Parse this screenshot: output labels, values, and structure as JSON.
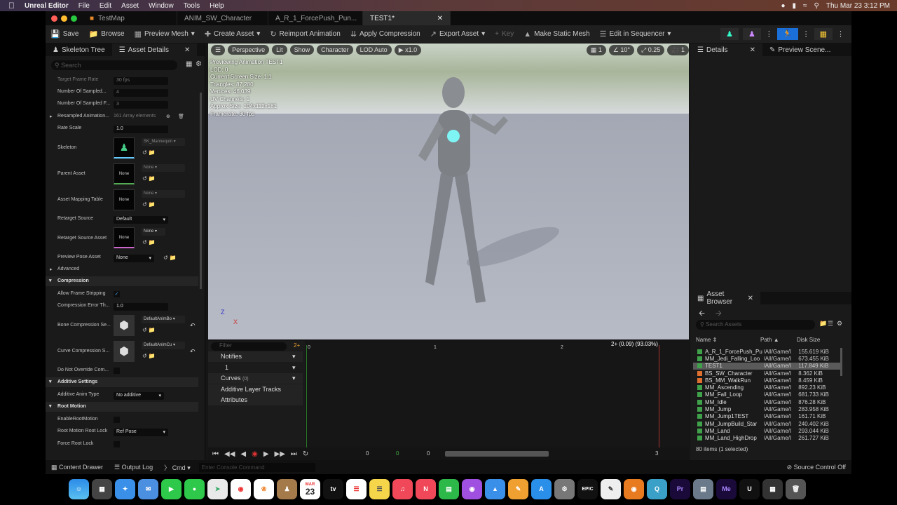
{
  "macbar": {
    "app": "Unreal Editor",
    "menus": [
      "File",
      "Edit",
      "Asset",
      "Window",
      "Tools",
      "Help"
    ],
    "clock": "Thu Mar 23  3:12 PM"
  },
  "tabs": [
    {
      "label": "TestMap"
    },
    {
      "label": "ANIM_SW_Character"
    },
    {
      "label": "A_R_1_ForcePush_Pun..."
    },
    {
      "label": "TEST1*"
    }
  ],
  "toolbar": {
    "save": "Save",
    "browse": "Browse",
    "preview_mesh": "Preview Mesh",
    "create_asset": "Create Asset",
    "reimport": "Reimport Animation",
    "apply_compression": "Apply Compression",
    "export_asset": "Export Asset",
    "key": "Key",
    "make_static": "Make Static Mesh",
    "edit_seq": "Edit in Sequencer"
  },
  "left": {
    "tab1": "Skeleton Tree",
    "tab2": "Asset Details",
    "search": "Search",
    "rows": [
      {
        "label": "Target Frame Rate",
        "value": "30 fps"
      },
      {
        "label": "Number Of Sampled...",
        "value": "4"
      },
      {
        "label": "Number Of Sampled F...",
        "value": "3"
      },
      {
        "label": "Resampled Animation...",
        "value": "161 Array elements"
      },
      {
        "label": "Rate Scale",
        "value": "1.0"
      }
    ],
    "skeleton": "Skeleton",
    "skeleton_val": "SK_Mannequin",
    "parent": "Parent Asset",
    "parent_val": "None",
    "none": "None",
    "mapping": "Asset Mapping Table",
    "retarget": "Retarget Source",
    "retarget_val": "Default",
    "retarget_asset": "Retarget Source Asset",
    "preview_pose": "Preview Pose Asset",
    "advanced": "Advanced",
    "compression": "Compression",
    "allow_strip": "Allow Frame Stripping",
    "comp_err": "Compression Error Th...",
    "comp_err_val": "1.0",
    "bone_comp": "Bone Compression Se...",
    "bone_comp_val": "DefaultAnimBo",
    "curve_comp": "Curve Compression S...",
    "curve_comp_val": "DefaultAnimCu",
    "no_override": "Do Not Override Com...",
    "additive": "Additive Settings",
    "add_type": "Additive Anim Type",
    "add_type_val": "No additive",
    "root": "Root Motion",
    "enable_root": "EnableRootMotion",
    "root_lock": "Root Motion Root Lock",
    "root_lock_val": "Ref Pose",
    "force_root": "Force Root Lock"
  },
  "viewport": {
    "perspective": "Perspective",
    "lit": "Lit",
    "show": "Show",
    "character": "Character",
    "lod": "LOD Auto",
    "speed": "x1.0",
    "grid": "10°",
    "scale": "0.25",
    "cam": "1",
    "num1": "1",
    "stats": [
      "Previewing Animation TEST1",
      "LOD: 0",
      "Current Screen Size: 1.1",
      "Triangles: 87,280",
      "Vertices: 46,039",
      "UV Channels: 1",
      "Approx Size: 104x112x181",
      "Framerate: 30 fps"
    ]
  },
  "timeline": {
    "filter": "Filter",
    "frame_count": "2+",
    "notifies": "Notifies",
    "track1": "1",
    "curves": "Curves",
    "curves_count": "(0)",
    "additive_tracks": "Additive Layer Tracks",
    "attributes": "Attributes",
    "marker": "2+ (0.09) (93.03%)",
    "ruler": [
      "0",
      "1",
      "2"
    ],
    "bottom": [
      "0",
      "0",
      "0",
      "3",
      "6"
    ]
  },
  "right": {
    "details": "Details",
    "preview_scene": "Preview Scene...",
    "asset_browser": "Asset Browser",
    "search": "Search Assets",
    "col_name": "Name",
    "col_path": "Path",
    "col_size": "Disk Size",
    "count": "80 items (1 selected)",
    "assets": [
      {
        "name": "A_R_1_ForcePush_Pu",
        "path": "/All/Game/I",
        "size": "155.619 KiB"
      },
      {
        "name": "MM_Jedi_Falling_Loo",
        "path": "/All/Game/I",
        "size": "673.455 KiB"
      },
      {
        "name": "TEST1",
        "path": "/All/Game/I",
        "size": "117.849 KiB"
      },
      {
        "name": "BS_SW_Character",
        "path": "/All/Game/I",
        "size": "8.362 KiB"
      },
      {
        "name": "BS_MM_WalkRun",
        "path": "/All/Game/I",
        "size": "8.459 KiB"
      },
      {
        "name": "MM_Ascending",
        "path": "/All/Game/I",
        "size": "892.23 KiB"
      },
      {
        "name": "MM_Fall_Loop",
        "path": "/All/Game/I",
        "size": "681.733 KiB"
      },
      {
        "name": "MM_Idle",
        "path": "/All/Game/I",
        "size": "876.28 KiB"
      },
      {
        "name": "MM_Jump",
        "path": "/All/Game/I",
        "size": "283.958 KiB"
      },
      {
        "name": "MM_Jump1TEST",
        "path": "/All/Game/I",
        "size": "161.71 KiB"
      },
      {
        "name": "MM_JumpBuild_Star",
        "path": "/All/Game/I",
        "size": "240.402 KiB"
      },
      {
        "name": "MM_Land",
        "path": "/All/Game/I",
        "size": "293.044 KiB"
      },
      {
        "name": "MM_Land_HighDrop",
        "path": "/All/Game/I",
        "size": "261.727 KiB"
      }
    ]
  },
  "status": {
    "content_drawer": "Content Drawer",
    "output_log": "Output Log",
    "cmd": "Cmd",
    "console": "Enter Console Command",
    "source_control": "Source Control Off"
  },
  "dock": {
    "calendar_month": "MAR",
    "calendar_day": "23",
    "epic": "EPIC",
    "ps": "Pr",
    "me": "Me"
  }
}
